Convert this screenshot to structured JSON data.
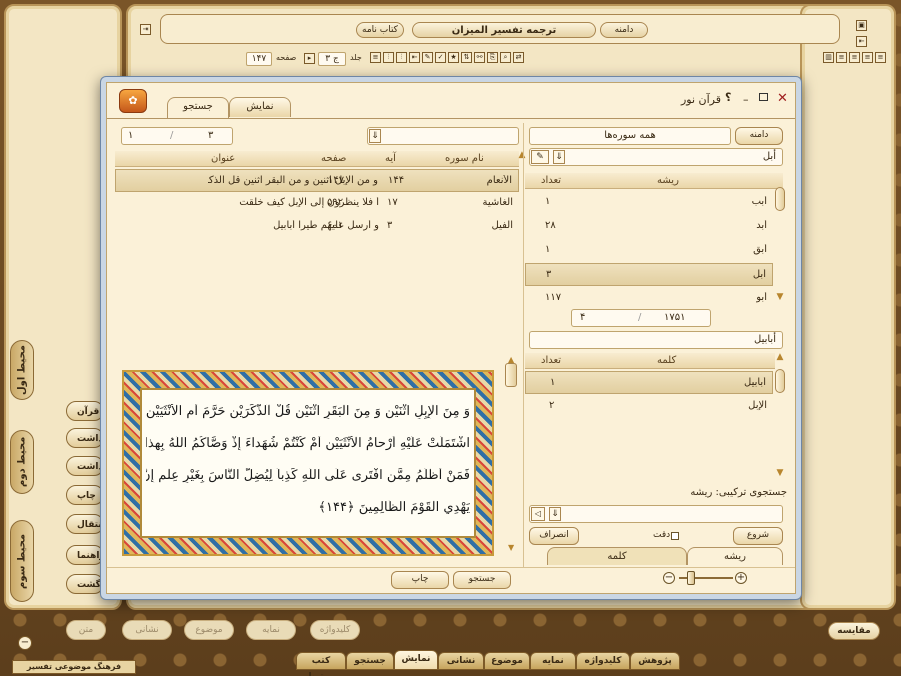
{
  "app": {
    "status_title": "فرهنگ موضوعی تفسیر المیزان",
    "window_title": "ترجمه تفسير الميزان",
    "book_button": "کتاب نامه",
    "domain_button": "دامنه",
    "page_label": "صفحه",
    "page_value": "۱۴۷",
    "volume_label": "جلد",
    "volume_value": "ج ۳",
    "compare_button": "مقایسه"
  },
  "left_side_tabs": [
    "محیط اول",
    "محیط دوم",
    "محیط سوم"
  ],
  "left_buttons": [
    "قرآن",
    "یادداشت نامه",
    "یادداشت",
    "چاپ",
    "انتقال",
    "راهنما",
    "بازگشت"
  ],
  "bottom_ghost_buttons": [
    "متن",
    "نشانی",
    "موضوع",
    "نمایه",
    "کلیدواژه"
  ],
  "bottom_tabs": [
    "کتب مرتبط",
    "جستجو",
    "نمایش",
    "نشانی",
    "موضوع",
    "نمایه",
    "کلیدواژه",
    "پژوهش"
  ],
  "dialog": {
    "title": "قرآن نور",
    "help": "؟",
    "tabs": {
      "search": "جستجو",
      "display": "نمایش"
    },
    "pager": {
      "current": "۳",
      "total": "۱"
    },
    "domain_button": "دامنه",
    "domain_value": "همه سوره‌ها",
    "root_search_value": "أبل",
    "roots_table": {
      "headers": {
        "root": "ریشه",
        "count": "تعداد"
      },
      "rows": [
        {
          "root": "أبب",
          "count": "۱"
        },
        {
          "root": "أبد",
          "count": "۲۸"
        },
        {
          "root": "أبق",
          "count": "۱"
        },
        {
          "root": "أبل",
          "count": "۳"
        },
        {
          "root": "أبو",
          "count": "۱۱۷"
        }
      ]
    },
    "roots_pager": {
      "total": "۱۷۵۱",
      "current": "۴"
    },
    "word_search_value": "أبابيل",
    "words_table": {
      "headers": {
        "word": "کلمه",
        "count": "تعداد"
      },
      "rows": [
        {
          "word": "أبابيل",
          "count": "۱"
        },
        {
          "word": "الإبل",
          "count": "۲"
        }
      ]
    },
    "combined_search_label": "جستجوی ترکیبی: ریشه",
    "start_button": "شروع",
    "cancel_button": "انصراف",
    "exact_label": "دقت",
    "mode_tabs": {
      "root": "ریشه",
      "word": "کلمه"
    },
    "results_table": {
      "headers": {
        "sura": "نام سوره",
        "ayah": "آیه",
        "page": "صفحه",
        "title": "عنوان"
      },
      "rows": [
        {
          "sura": "الأنعام",
          "ayah": "۱۴۴",
          "page": "۱۴۷",
          "title": "و من الإبل اثنين و من البقر اثنين قل آلذكر"
        },
        {
          "sura": "الغاشية",
          "ayah": "۱۷",
          "page": "۵۹۲",
          "title": "أ فلا ينظرون إلى الإبل كيف خلقت"
        },
        {
          "sura": "الفيل",
          "ayah": "۳",
          "page": "۶۰۱",
          "title": "و أرسل عليهم طيرا أبابيل"
        }
      ]
    },
    "ayah_lines": [
      "وَ مِنَ الْإِبِلِ اثْنَيْنِ وَ مِنَ الْبَقَرِ اثْنَيْنِ قُلْ آلذَّكَرَيْنِ حَرَّمَ أَمِ الْأُنْثَيَيْنِ أَمَّا",
      "اشْتَمَلَتْ عَلَيْهِ أَرْحامُ الْأُنْثَيَيْنِ أَمْ كُنْتُمْ شُهَداءَ إِذْ وَصَّاكُمُ اللَّهُ بِهذا",
      "فَمَنْ أَظْلَمُ مِمَّنِ افْتَرى عَلَى اللَّهِ كَذِباً لِيُضِلَّ النَّاسَ بِغَيْرِ عِلْمٍ إِنَّ اللَّهَ لا",
      "يَهْدِي الْقَوْمَ الظَّالِمِينَ ﴿۱۴۴﴾"
    ],
    "print_button": "چاپ",
    "search_button": "جستجو"
  },
  "colors": {
    "accent": "#b8862e",
    "frame": "#6b4a22",
    "panel": "#fbf1d8"
  }
}
